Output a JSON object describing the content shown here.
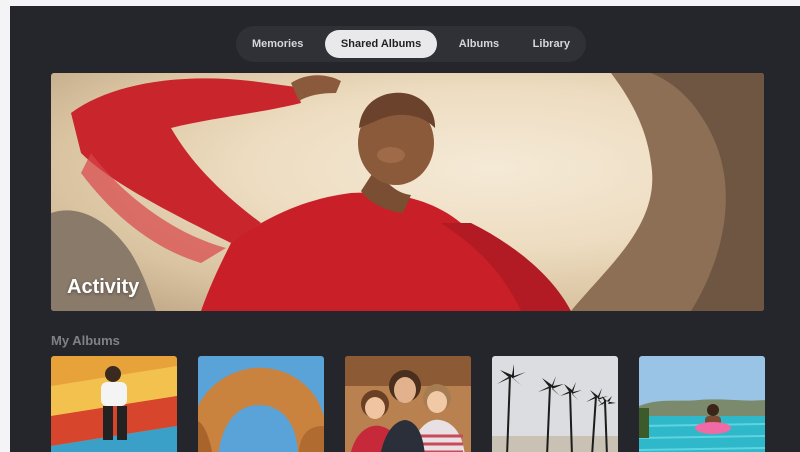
{
  "tabs": [
    {
      "label": "Memories",
      "active": false
    },
    {
      "label": "Shared Albums",
      "active": true
    },
    {
      "label": "Albums",
      "active": false
    },
    {
      "label": "Library",
      "active": false
    }
  ],
  "hero": {
    "label": "Activity"
  },
  "albums_section": {
    "title": "My Albums"
  },
  "colors": {
    "background": "#24262b",
    "tab_bar": "#2f3136",
    "tab_active": "#e9e9ec",
    "section_title": "#7f8188"
  }
}
